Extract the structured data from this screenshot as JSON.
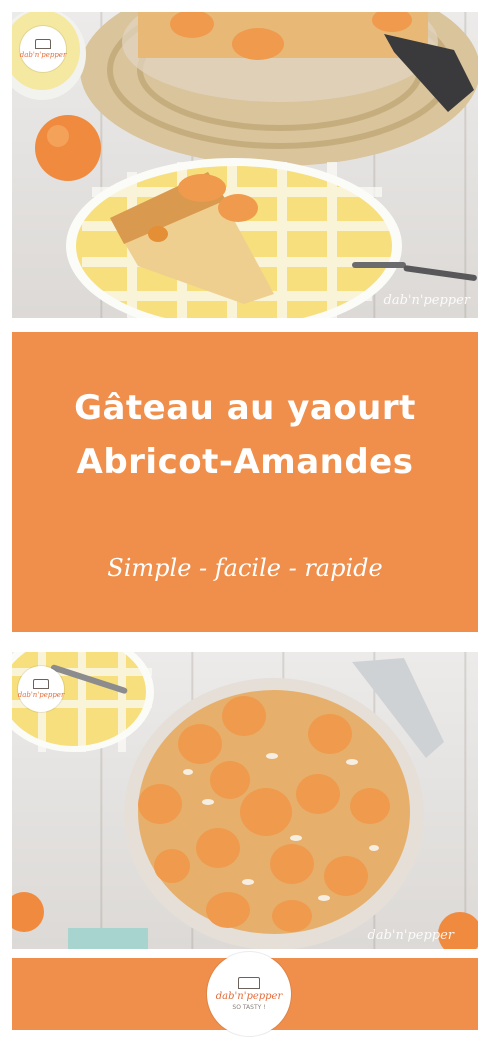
{
  "title": {
    "line1": "Gâteau au yaourt",
    "line2": "Abricot-Amandes",
    "tagline": "Simple - facile - rapide"
  },
  "brand": {
    "name": "dab'n'pepper",
    "tagline": "SO TASTY !",
    "watermark_top": "dab'n'pepper",
    "watermark_bottom": "dab'n'pepper"
  },
  "photos": {
    "top": "cake-slice-on-plate",
    "bottom": "whole-apricot-cake"
  },
  "colors": {
    "banner": "#f08f4b",
    "text": "#ffffff",
    "cake": "#e6b06c",
    "apricot": "#ef9a4c",
    "plate_check": "#f4d54f"
  }
}
